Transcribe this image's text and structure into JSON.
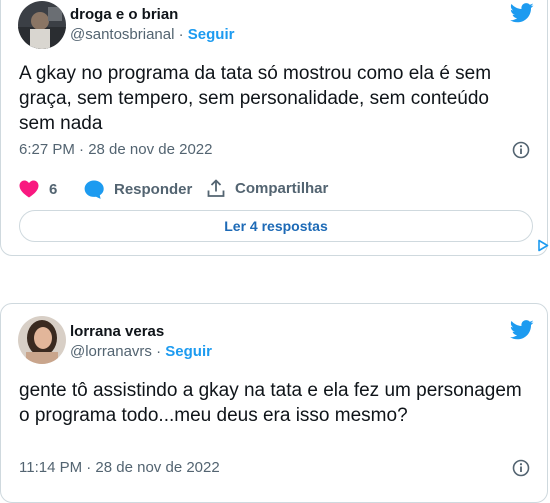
{
  "tweets": [
    {
      "author": {
        "name": "droga e o brian",
        "handle": "@santosbrianal"
      },
      "follow_label": "Seguir",
      "separator": "·",
      "text": "A gkay no programa da tata só mostrou como ela é sem graça, sem tempero, sem personalidade, sem conteúdo sem nada",
      "timestamp": "6:27 PM · 28 de nov de 2022",
      "likes": "6",
      "reply_label": "Responder",
      "share_label": "Compartilhar",
      "read_replies_label": "Ler 4 respostas"
    },
    {
      "author": {
        "name": "lorrana veras",
        "handle": "@lorranavrs"
      },
      "follow_label": "Seguir",
      "separator": "·",
      "text": "gente tô assistindo a gkay na tata e ela fez um personagem o programa todo...meu deus era isso mesmo?",
      "timestamp": "11:14 PM · 28 de nov de 2022"
    }
  ],
  "colors": {
    "accent": "#1d9bf0",
    "like": "#f91880",
    "muted": "#536471",
    "border": "#cfd9de"
  },
  "icons": [
    "twitter-bird-icon",
    "info-icon",
    "heart-icon",
    "reply-bubble-icon",
    "share-icon",
    "adchoices-icon"
  ]
}
